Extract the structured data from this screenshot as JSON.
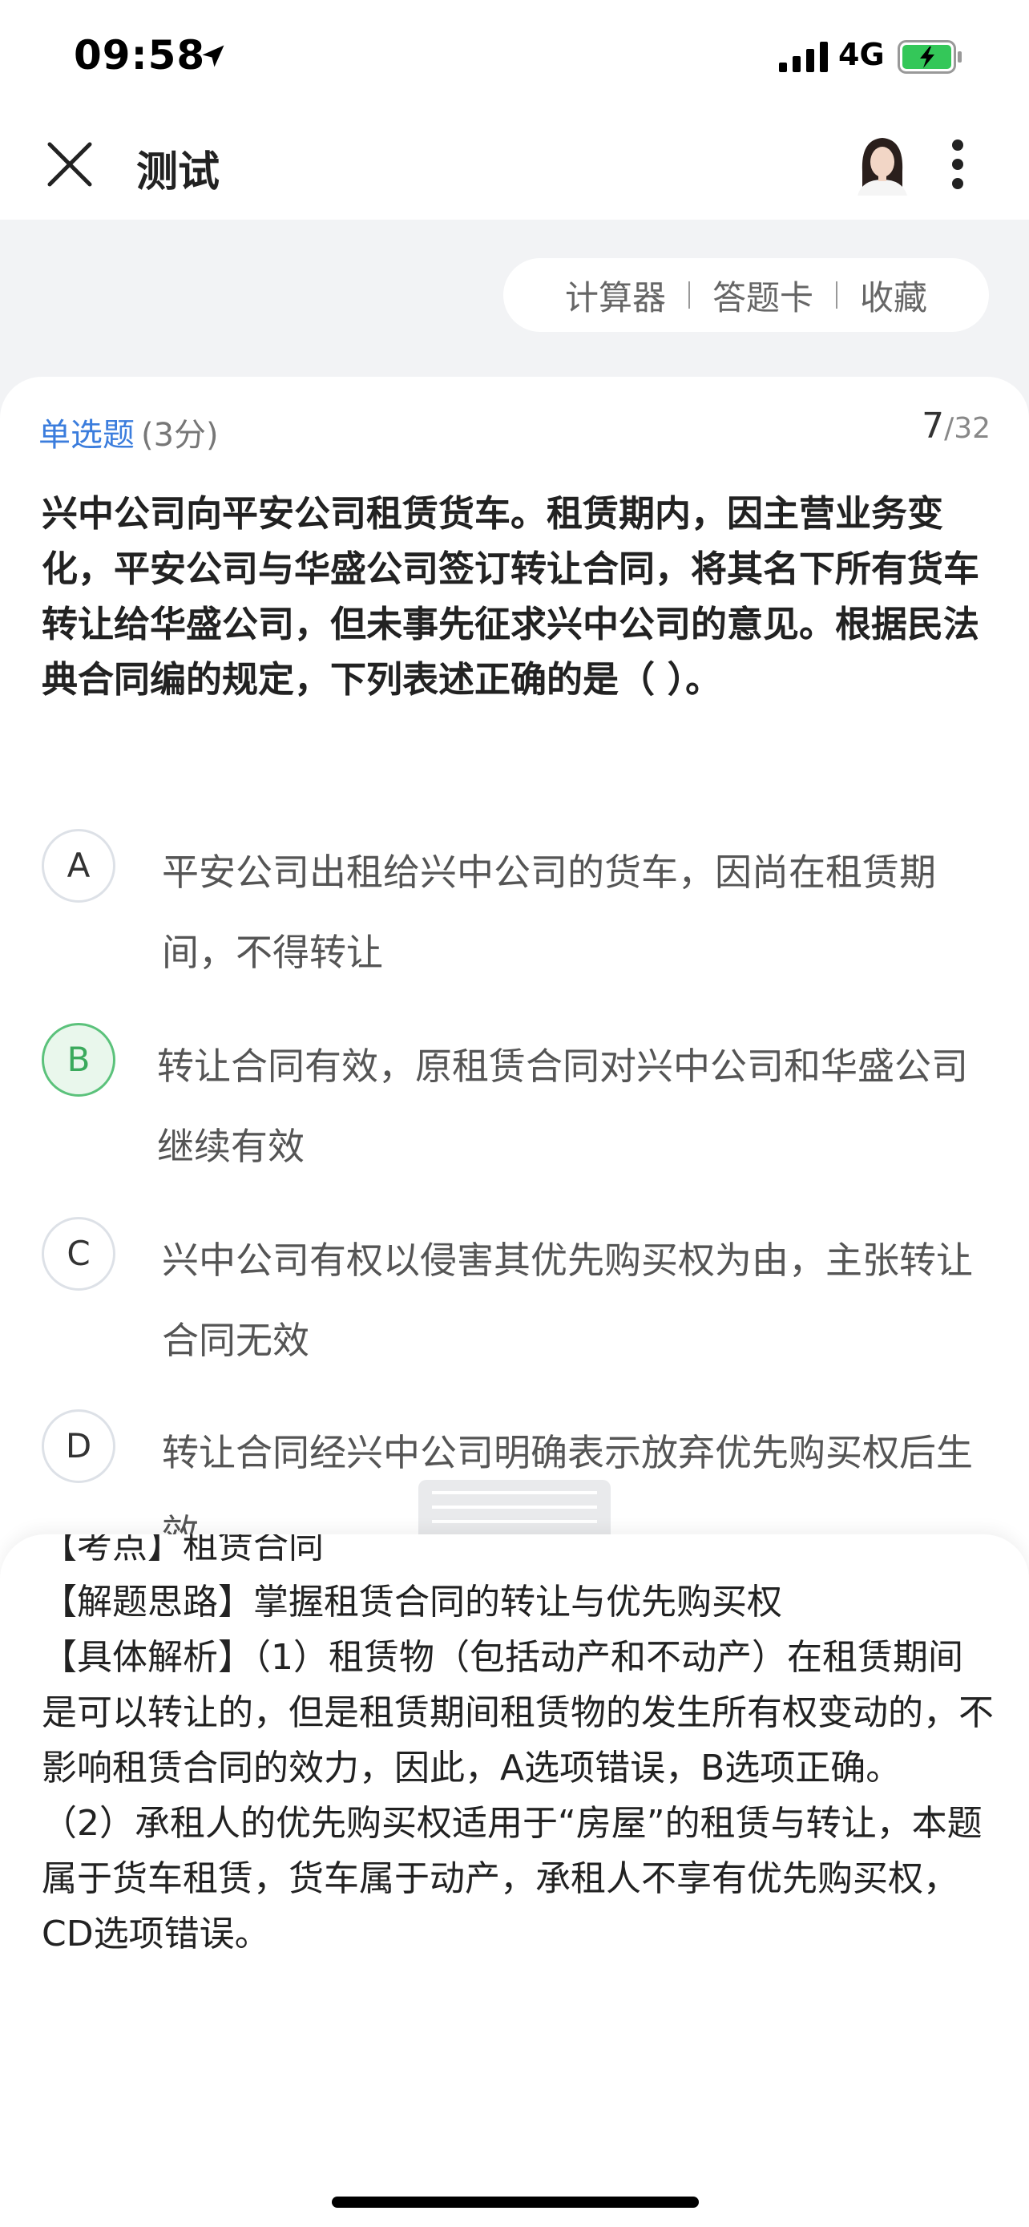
{
  "status_bar": {
    "time": "09:58",
    "carrier": "4G"
  },
  "nav": {
    "title": "测试"
  },
  "toolbar": {
    "calculator": "计算器",
    "answer_card": "答题卡",
    "favorite": "收藏"
  },
  "question": {
    "type": "单选题",
    "score": "(3分)",
    "current": "7",
    "total": "/32",
    "text": "兴中公司向平安公司租赁货车。租赁期内，因主营业务变化，平安公司与华盛公司签订转让合同，将其名下所有货车转让给华盛公司，但未事先征求兴中公司的意见。根据民法典合同编的规定，下列表述正确的是（ ）。"
  },
  "options": [
    {
      "letter": "A",
      "text": "平安公司出租给兴中公司的货车，因尚在租赁期间，不得转让"
    },
    {
      "letter": "B",
      "text": "转让合同有效，原租赁合同对兴中公司和华盛公司继续有效"
    },
    {
      "letter": "C",
      "text": "兴中公司有权以侵害其优先购买权为由，主张转让合同无效"
    },
    {
      "letter": "D",
      "text": "转让合同经兴中公司明确表示放弃优先购买权后生效"
    }
  ],
  "explanation": {
    "partial_line": "【考点】租赁合同",
    "approach": "【解题思路】掌握租赁合同的转让与优先购买权",
    "detail_1": "【具体解析】（1）租赁物（包括动产和不动产）在租赁期间是可以转让的，但是租赁期间租赁物的发生所有权变动的，不影响租赁合同的效力，因此，A选项错误，B选项正确。",
    "detail_2": "（2）承租人的优先购买权适用于“房屋”的租赁与转让，本题属于货车租赁，货车属于动产，承租人不享有优先购买权，CD选项错误。"
  },
  "colors": {
    "accent": "#3b7ddd",
    "correct": "#5bc27b"
  }
}
